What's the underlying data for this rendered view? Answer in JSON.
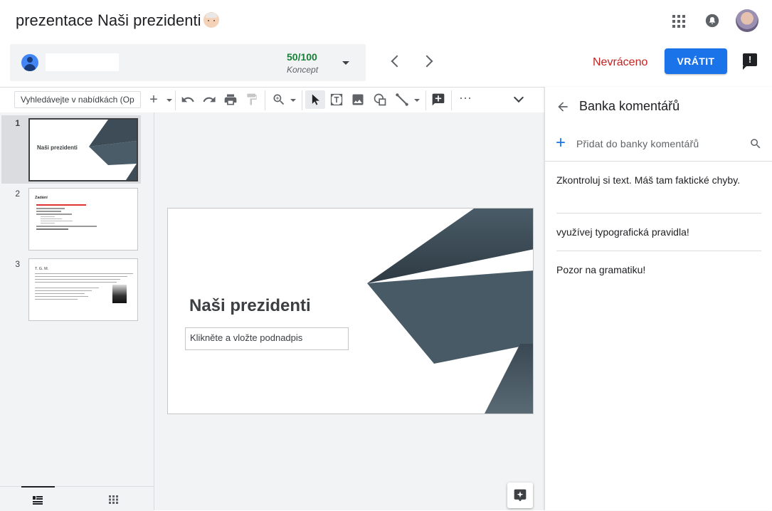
{
  "header": {
    "title": "prezentace Naši prezidenti"
  },
  "grading": {
    "score": "50/100",
    "status": "Koncept",
    "return_status": "Nevráceno",
    "return_button": "VRÁTIT"
  },
  "toolbar": {
    "menu_search_placeholder": "Vyhledávejte v nabídkách (Opt"
  },
  "filmstrip": {
    "slides": [
      {
        "number": "1",
        "title": "Naši prezidenti"
      },
      {
        "number": "2",
        "title": "Zadání"
      },
      {
        "number": "3",
        "title": "T. G. M."
      }
    ]
  },
  "slide": {
    "title": "Naši prezidenti",
    "subtitle_placeholder": "Klikněte a vložte podnadpis"
  },
  "comment_bank": {
    "title": "Banka komentářů",
    "add_label": "Přidat do banky komentářů",
    "comments": [
      "Zkontroluj si text. Máš tam faktické chyby.",
      "využívej typografická pravidla!",
      "Pozor na gramatiku!"
    ]
  },
  "colors": {
    "accent": "#1a73e8",
    "score_green": "#188038",
    "status_red": "#c5221f",
    "slide_shape": "#4a5c68"
  }
}
